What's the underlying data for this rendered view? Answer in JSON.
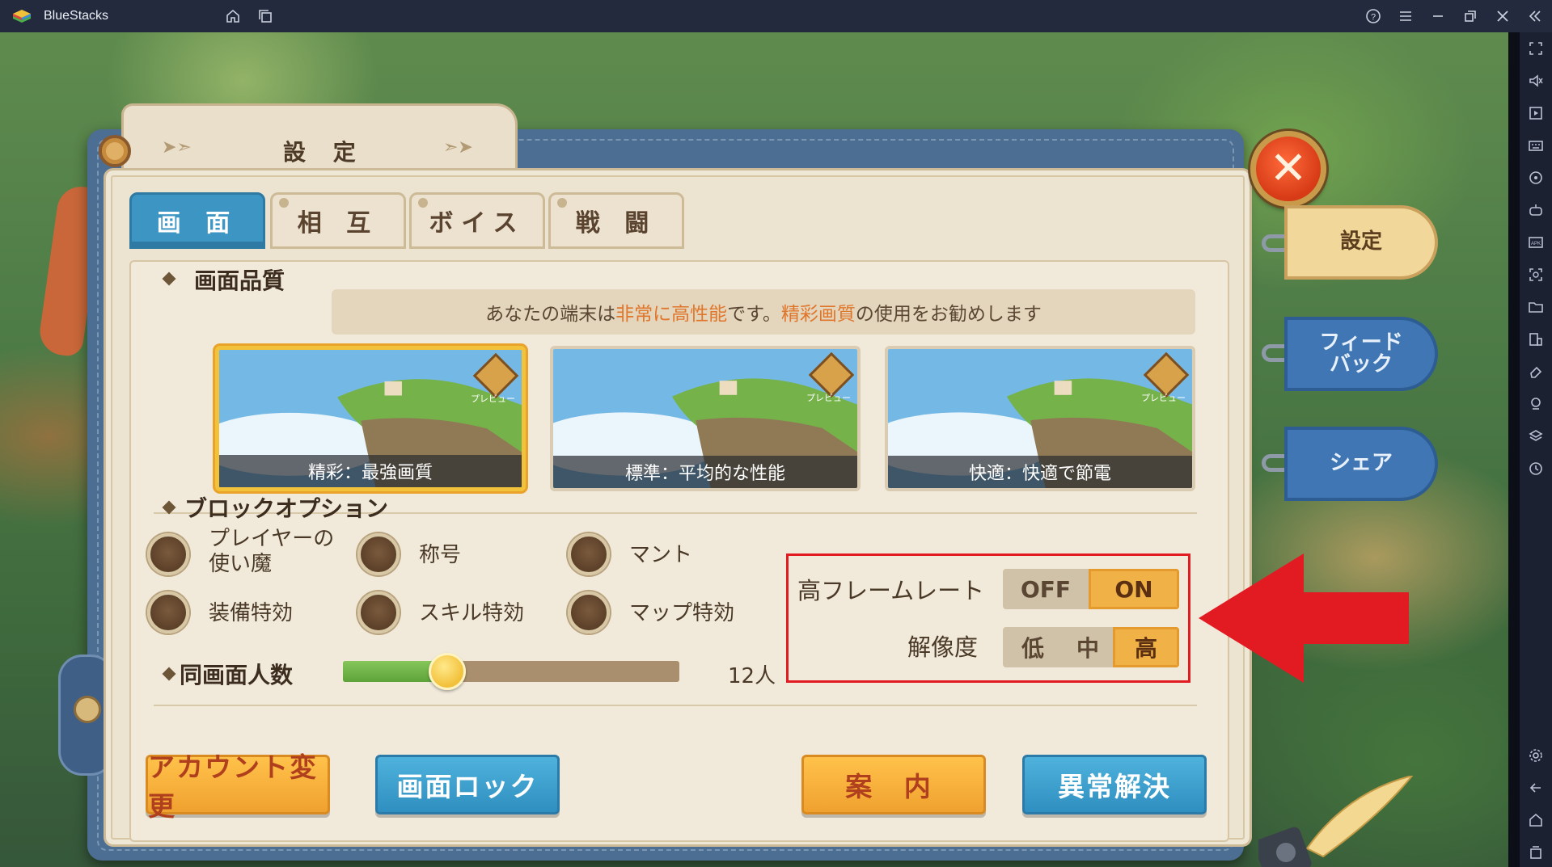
{
  "window": {
    "app_title": "BlueStacks",
    "icons": [
      "home-icon",
      "multi-instance-icon",
      "help-icon",
      "menu-icon",
      "minimize-icon",
      "restore-icon",
      "close-icon",
      "collapse-sidebar-icon"
    ]
  },
  "sidebar_icons": [
    "fullscreen-icon",
    "volume-icon",
    "media-icon",
    "keyboard-icon",
    "rotate-icon",
    "gamepad-icon",
    "apk-icon",
    "screenshot-icon",
    "folder-icon",
    "multi-instance-icon",
    "eraser-icon",
    "location-icon",
    "layers-icon",
    "macro-icon",
    "settings-icon",
    "back-icon",
    "home-icon",
    "recent-apps-icon"
  ],
  "dialog": {
    "title": "設 定",
    "tabs": [
      {
        "label": "画 面",
        "active": true
      },
      {
        "label": "相 互",
        "active": false
      },
      {
        "label": "ボイス",
        "active": false
      },
      {
        "label": "戦 闘",
        "active": false
      }
    ],
    "side_tabs": [
      {
        "label": "設定",
        "active": true
      },
      {
        "label": "フィード\nバック",
        "active": false
      },
      {
        "label": "シェア",
        "active": false
      }
    ]
  },
  "quality": {
    "section_label": "画面品質",
    "banner_pre": "あなたの端末は",
    "banner_hl1": "非常に高性能",
    "banner_mid": "です。",
    "banner_hl2": "精彩画質",
    "banner_post": "の使用をお勧めします",
    "cards": [
      {
        "caption": "精彩：最強画質",
        "selected": true,
        "badge": "プレビュー"
      },
      {
        "caption": "標準：平均的な性能",
        "selected": false,
        "badge": "プレビュー"
      },
      {
        "caption": "快適：快適で節電",
        "selected": false,
        "badge": "プレビュー"
      }
    ]
  },
  "block_options": {
    "section_label": "ブロックオプション",
    "items": [
      "プレイヤーの\n使い魔",
      "称号",
      "マント",
      "装備特効",
      "スキル特効",
      "マップ特効"
    ]
  },
  "frame_rate": {
    "label": "高フレームレート",
    "options": [
      "OFF",
      "ON"
    ],
    "selected": "ON"
  },
  "resolution": {
    "label": "解像度",
    "options": [
      "低",
      "中",
      "高"
    ],
    "selected": "高"
  },
  "players_on_screen": {
    "label": "同画面人数",
    "value_text": "12人",
    "level": 0.31
  },
  "buttons": {
    "account_change": "アカウント変更",
    "screen_lock": "画面ロック",
    "guide": "案 内",
    "troubleshoot": "異常解決"
  },
  "colors": {
    "accent_blue": "#3d95c4",
    "accent_orange": "#f0b147",
    "highlight_text": "#e0762c",
    "annotation_red": "#e21b23"
  }
}
